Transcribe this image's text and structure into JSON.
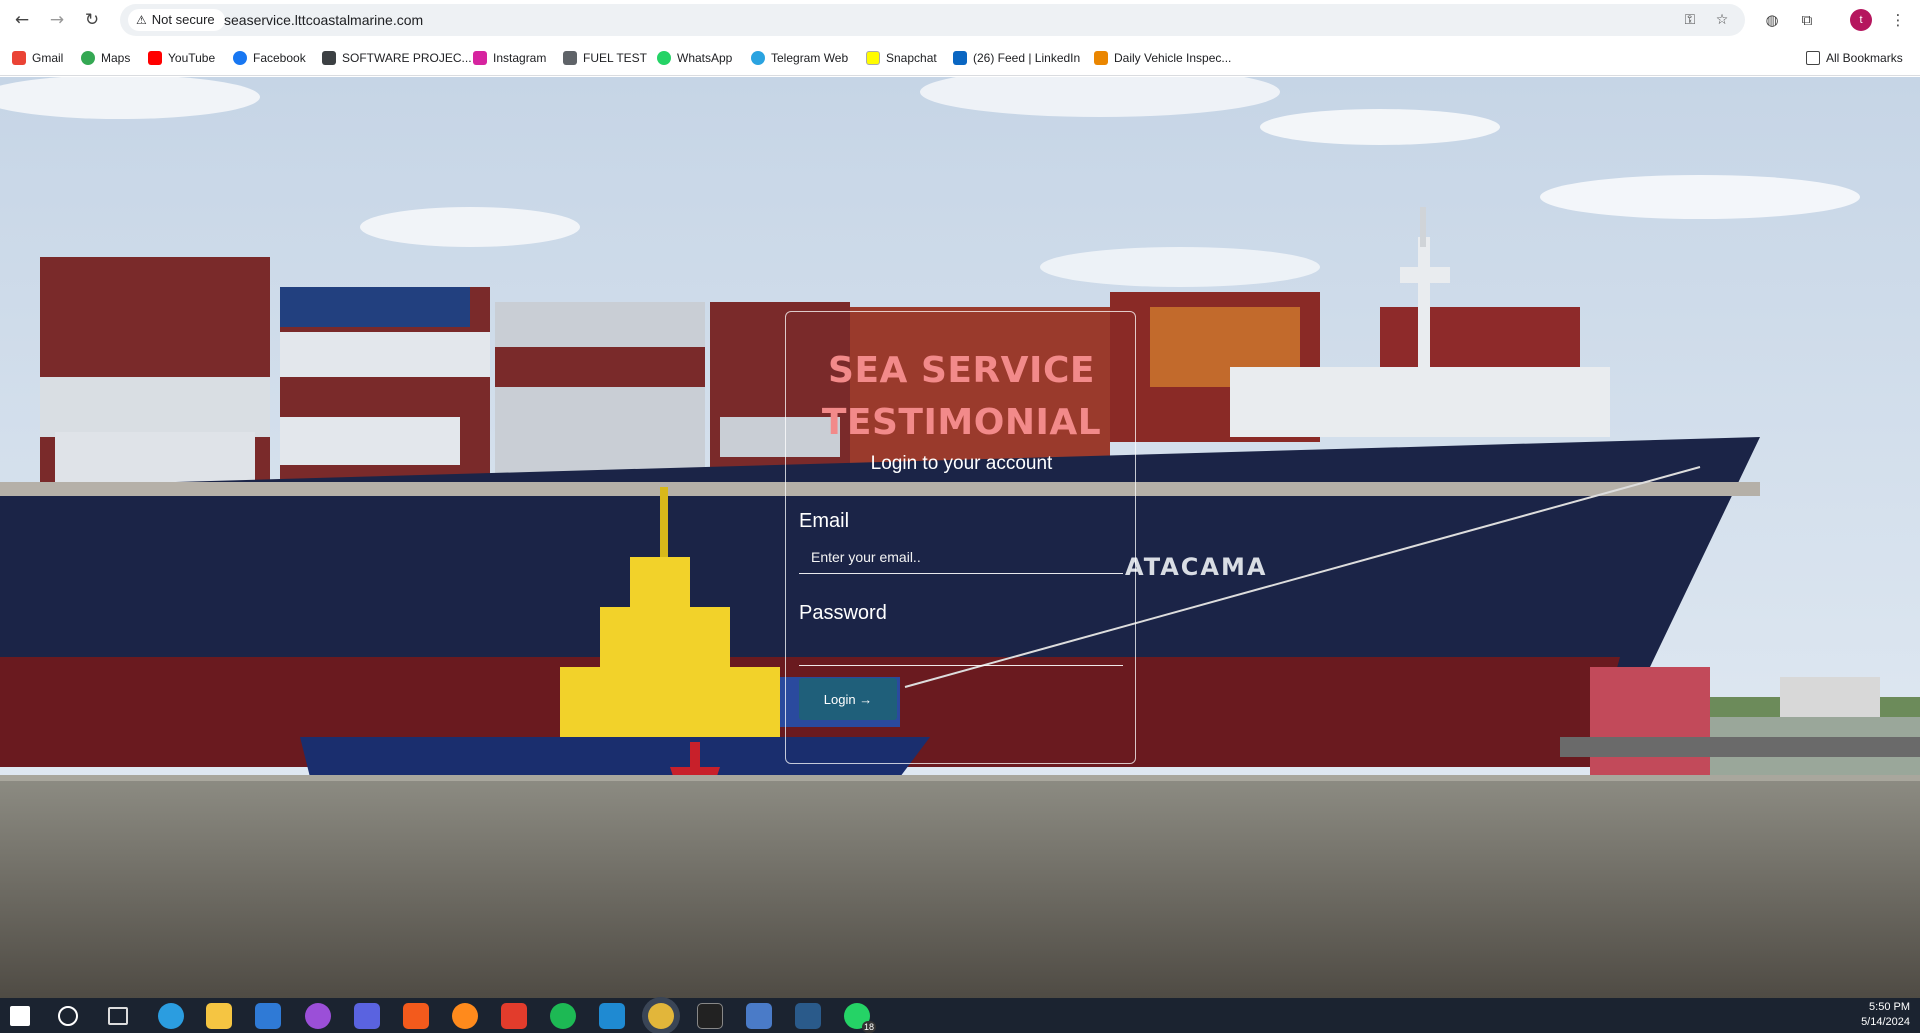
{
  "browser": {
    "not_secure_label": "Not secure",
    "url": "seaservice.lttcoastalmarine.com",
    "profile_initial": "t",
    "nav_icons": [
      "back-arrow-icon",
      "forward-arrow-icon",
      "reload-icon"
    ],
    "omnibox_icons": [
      "password-key-icon",
      "bookmark-star-icon"
    ],
    "toolbar_icons": [
      "extension-shield-icon",
      "extensions-puzzle-icon",
      "menu-kebab-icon"
    ]
  },
  "bookmarks": {
    "items": [
      {
        "label": "Gmail",
        "icon": "gmail-icon",
        "color": "#ea4335"
      },
      {
        "label": "Maps",
        "icon": "maps-pin-icon",
        "color": "#34a853"
      },
      {
        "label": "YouTube",
        "icon": "youtube-icon",
        "color": "#ff0000"
      },
      {
        "label": "Facebook",
        "icon": "facebook-icon",
        "color": "#1877f2"
      },
      {
        "label": "SOFTWARE PROJEC...",
        "icon": "folder-image-icon",
        "color": "#3c4043"
      },
      {
        "label": "Instagram",
        "icon": "instagram-icon",
        "color": "#d6249f"
      },
      {
        "label": "FUEL TEST",
        "icon": "document-icon",
        "color": "#5f6368"
      },
      {
        "label": "WhatsApp",
        "icon": "whatsapp-icon",
        "color": "#25d366"
      },
      {
        "label": "Telegram Web",
        "icon": "telegram-icon",
        "color": "#2aa3e0"
      },
      {
        "label": "Snapchat",
        "icon": "snapchat-icon",
        "color": "#fffc00"
      },
      {
        "label": "(26) Feed | LinkedIn",
        "icon": "linkedin-icon",
        "color": "#0a66c2"
      },
      {
        "label": "Daily Vehicle Inspec...",
        "icon": "forms-icon",
        "color": "#ea8600"
      }
    ],
    "all_bookmarks_label": "All Bookmarks"
  },
  "login": {
    "title_line1": "SEA SERVICE",
    "title_line2": "TESTIMONIAL",
    "subtitle": "Login to your account",
    "email_label": "Email",
    "email_placeholder": "Enter your email..",
    "email_value": "",
    "password_label": "Password",
    "password_value": "",
    "button_label": "Login →"
  },
  "scene": {
    "ship_name": "ATACAMA"
  },
  "taskbar": {
    "icons": [
      "windows-start-icon",
      "search-icon",
      "task-view-icon",
      "edge-icon",
      "file-explorer-icon",
      "mail-icon",
      "copilot-icon",
      "app-icon",
      "brave-icon",
      "firefox-icon",
      "office-icon",
      "spotify-icon",
      "vscode-icon",
      "chrome-icon",
      "terminal-icon",
      "remote-desktop-icon",
      "dev-app-icon",
      "whatsapp-icon"
    ],
    "whatsapp_badge": "18",
    "time": "5:50 PM",
    "date": "5/14/2024"
  },
  "colors": {
    "title": "#f28a8a",
    "button": "#1f5f7a"
  }
}
